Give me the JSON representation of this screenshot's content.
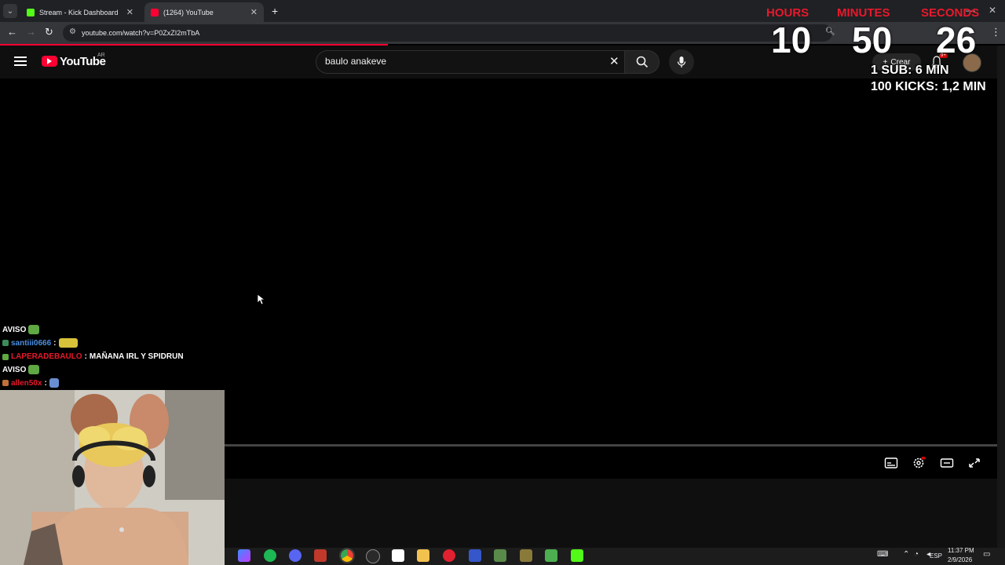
{
  "browser": {
    "tabs": [
      {
        "title": "Stream - Kick Dashboard",
        "active": false,
        "favicon_color": "#53fc18"
      },
      {
        "title": "(1264) YouTube",
        "active": true,
        "favicon_color": "#ff0033"
      }
    ],
    "url": "youtube.com/watch?v=P0ZxZI2mTbA"
  },
  "youtube": {
    "logo_text": "YouTube",
    "country_code": "AR",
    "search_query": "baulo anakeve",
    "create_label": "Crear",
    "notification_badge": "9+"
  },
  "overlay": {
    "timer_labels": {
      "hours": "HOURS",
      "minutes": "MINUTES",
      "seconds": "SECONDS"
    },
    "timer_values": {
      "hours": "10",
      "minutes": "50",
      "seconds": "26"
    },
    "goals": [
      "1 SUB: 6 MIN",
      "100 KICKS: 1,2 MIN"
    ]
  },
  "chat": [
    {
      "user": "AVISO",
      "message": "",
      "user_color": "#ffffff",
      "type": "notice"
    },
    {
      "user": "santiii0666",
      "message": "",
      "user_color": "#4a90e2",
      "type": "chat",
      "separator": ":"
    },
    {
      "user": "LAPERADEBAULO",
      "message": "MAÑANA IRL Y SPIDRUN",
      "user_color": "#e8192c",
      "type": "chat",
      "separator": ":"
    },
    {
      "user": "AVISO",
      "message": "",
      "user_color": "#ffffff",
      "type": "notice"
    },
    {
      "user": "allen50x",
      "message": "",
      "user_color": "#e8192c",
      "type": "chat",
      "separator": ":"
    }
  ],
  "taskbar": {
    "time": "11:37 PM",
    "date": "2/9/2026",
    "language": "ESP"
  }
}
